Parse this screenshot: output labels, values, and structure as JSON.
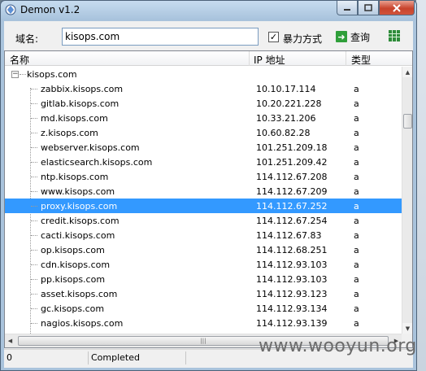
{
  "window": {
    "title": "Demon v1.2"
  },
  "toolbar": {
    "domain_label": "域名:",
    "domain_value": "kisops.com",
    "bruteforce_label": "暴力方式",
    "bruteforce_checked": true,
    "query_label": "查询"
  },
  "columns": [
    "名称",
    "IP 地址",
    "类型"
  ],
  "root": {
    "name": "kisops.com"
  },
  "rows": [
    {
      "name": "zabbix.kisops.com",
      "ip": "10.10.17.114",
      "type": "a"
    },
    {
      "name": "gitlab.kisops.com",
      "ip": "10.20.221.228",
      "type": "a"
    },
    {
      "name": "md.kisops.com",
      "ip": "10.33.21.206",
      "type": "a"
    },
    {
      "name": "z.kisops.com",
      "ip": "10.60.82.28",
      "type": "a"
    },
    {
      "name": "webserver.kisops.com",
      "ip": "101.251.209.18",
      "type": "a"
    },
    {
      "name": "elasticsearch.kisops.com",
      "ip": "101.251.209.42",
      "type": "a"
    },
    {
      "name": "ntp.kisops.com",
      "ip": "114.112.67.208",
      "type": "a"
    },
    {
      "name": "www.kisops.com",
      "ip": "114.112.67.209",
      "type": "a"
    },
    {
      "name": "proxy.kisops.com",
      "ip": "114.112.67.252",
      "type": "a",
      "selected": true
    },
    {
      "name": "credit.kisops.com",
      "ip": "114.112.67.254",
      "type": "a"
    },
    {
      "name": "cacti.kisops.com",
      "ip": "114.112.67.83",
      "type": "a"
    },
    {
      "name": "op.kisops.com",
      "ip": "114.112.68.251",
      "type": "a"
    },
    {
      "name": "cdn.kisops.com",
      "ip": "114.112.93.103",
      "type": "a"
    },
    {
      "name": "pp.kisops.com",
      "ip": "114.112.93.103",
      "type": "a"
    },
    {
      "name": "asset.kisops.com",
      "ip": "114.112.93.123",
      "type": "a"
    },
    {
      "name": "gc.kisops.com",
      "ip": "114.112.93.134",
      "type": "a"
    },
    {
      "name": "nagios.kisops.com",
      "ip": "114.112.93.139",
      "type": "a"
    }
  ],
  "status": {
    "count": "0",
    "message": "Completed"
  },
  "watermark": "www.wooyun.org",
  "colors": {
    "selection": "#3399ff",
    "query_icon": "#2f9f3a",
    "close_button": "#c8432c"
  }
}
